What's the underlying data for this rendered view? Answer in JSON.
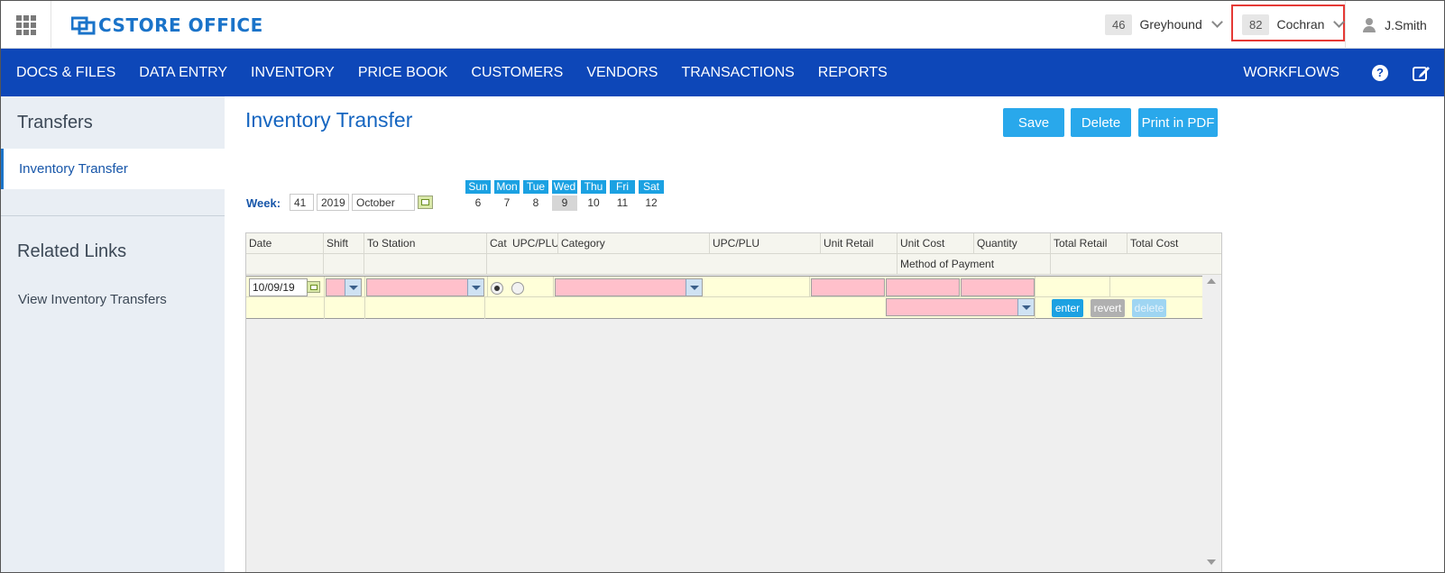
{
  "header": {
    "logo_text": "CSTORE OFFICE",
    "stores": [
      {
        "number": "46",
        "name": "Greyhound"
      },
      {
        "number": "82",
        "name": "Cochran"
      }
    ],
    "user": "J.Smith"
  },
  "nav": {
    "items": [
      "DOCS & FILES",
      "DATA ENTRY",
      "INVENTORY",
      "PRICE BOOK",
      "CUSTOMERS",
      "VENDORS",
      "TRANSACTIONS",
      "REPORTS"
    ],
    "workflows": "WORKFLOWS",
    "help_glyph": "?"
  },
  "sidebar": {
    "title": "Transfers",
    "active_item": "Inventory Transfer",
    "related_title": "Related Links",
    "related_links": [
      "View Inventory Transfers"
    ]
  },
  "main": {
    "title": "Inventory Transfer",
    "buttons": {
      "save": "Save",
      "delete": "Delete",
      "print": "Print in PDF"
    },
    "week": {
      "label": "Week:",
      "number": "41",
      "year": "2019",
      "month": "October",
      "days": [
        {
          "name": "Sun",
          "num": "6"
        },
        {
          "name": "Mon",
          "num": "7"
        },
        {
          "name": "Tue",
          "num": "8"
        },
        {
          "name": "Wed",
          "num": "9"
        },
        {
          "name": "Thu",
          "num": "10"
        },
        {
          "name": "Fri",
          "num": "11"
        },
        {
          "name": "Sat",
          "num": "12"
        }
      ],
      "selected_day": "Wed"
    },
    "grid": {
      "headers": [
        "Date",
        "Shift",
        "To Station",
        "Cat",
        "UPC/PLU",
        "Category",
        "UPC/PLU",
        "Unit Retail",
        "Unit Cost",
        "Quantity",
        "Total Retail",
        "Total Cost"
      ],
      "subheader": "Method of Payment",
      "entry": {
        "date": "10/09/19",
        "cat_selected": true
      },
      "row_buttons": {
        "enter": "enter",
        "revert": "revert",
        "delete": "delete"
      }
    }
  },
  "colors": {
    "nav_bg": "#0d47b8",
    "accent": "#29a8eb",
    "title": "#1565c0",
    "sidebar_bg": "#e9eef4",
    "required_field": "#ffc0cb",
    "entry_row": "#ffffd9",
    "highlight_box": "#e53935"
  },
  "icons": {
    "apps": "grid-icon",
    "store_dropdown": "chevron-down-icon",
    "user": "user-icon",
    "help": "question-circle-icon",
    "edit": "edit-icon",
    "calendar": "calendar-icon"
  }
}
